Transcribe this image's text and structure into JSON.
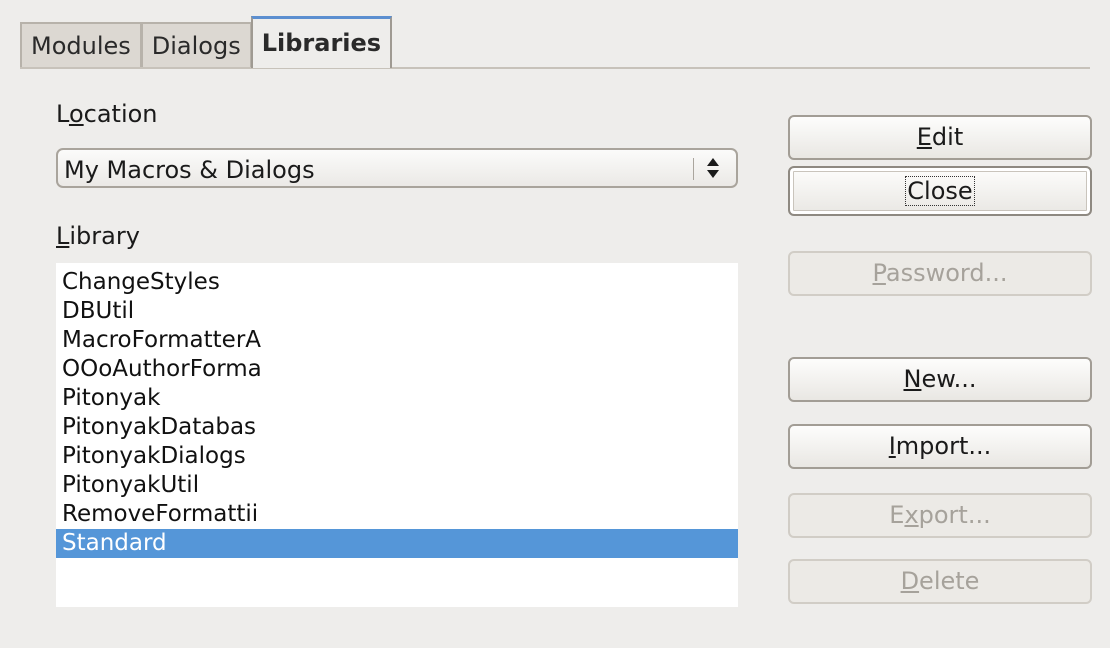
{
  "tabs": [
    {
      "label": "Modules",
      "active": false
    },
    {
      "label": "Dialogs",
      "active": false
    },
    {
      "label": "Libraries",
      "active": true
    }
  ],
  "location": {
    "label_pre": "L",
    "label_mnemonic": "o",
    "label_post": "cation",
    "selected_value": "My Macros & Dialogs"
  },
  "library": {
    "label_mnemonic": "L",
    "label_post": "ibrary",
    "items": [
      "ChangeStyles",
      "DBUtil",
      "MacroFormatterA",
      "OOoAuthorForma",
      "Pitonyak",
      "PitonyakDatabas",
      "PitonyakDialogs",
      "PitonyakUtil",
      "RemoveFormattii",
      "Standard"
    ],
    "selected_item": "Standard"
  },
  "buttons": {
    "edit": {
      "mnemonic": "E",
      "rest": "dit",
      "enabled": true
    },
    "close": {
      "label": "Close",
      "enabled": true,
      "default": true
    },
    "password": {
      "mnemonic": "P",
      "rest": "assword...",
      "enabled": false
    },
    "new": {
      "mnemonic": "N",
      "rest": "ew...",
      "enabled": true
    },
    "import": {
      "mnemonic": "I",
      "rest": "mport...",
      "enabled": true
    },
    "export": {
      "pre": "E",
      "mnemonic": "x",
      "rest": "port...",
      "enabled": false
    },
    "delete": {
      "mnemonic": "D",
      "rest": "elete",
      "enabled": false
    }
  },
  "colors": {
    "dialog_bg": "#eeedeb",
    "selection": "#5596d8",
    "active_tab_accent": "#5c8fd0"
  },
  "icons": {
    "select_arrows": "updown-arrows-icon"
  }
}
